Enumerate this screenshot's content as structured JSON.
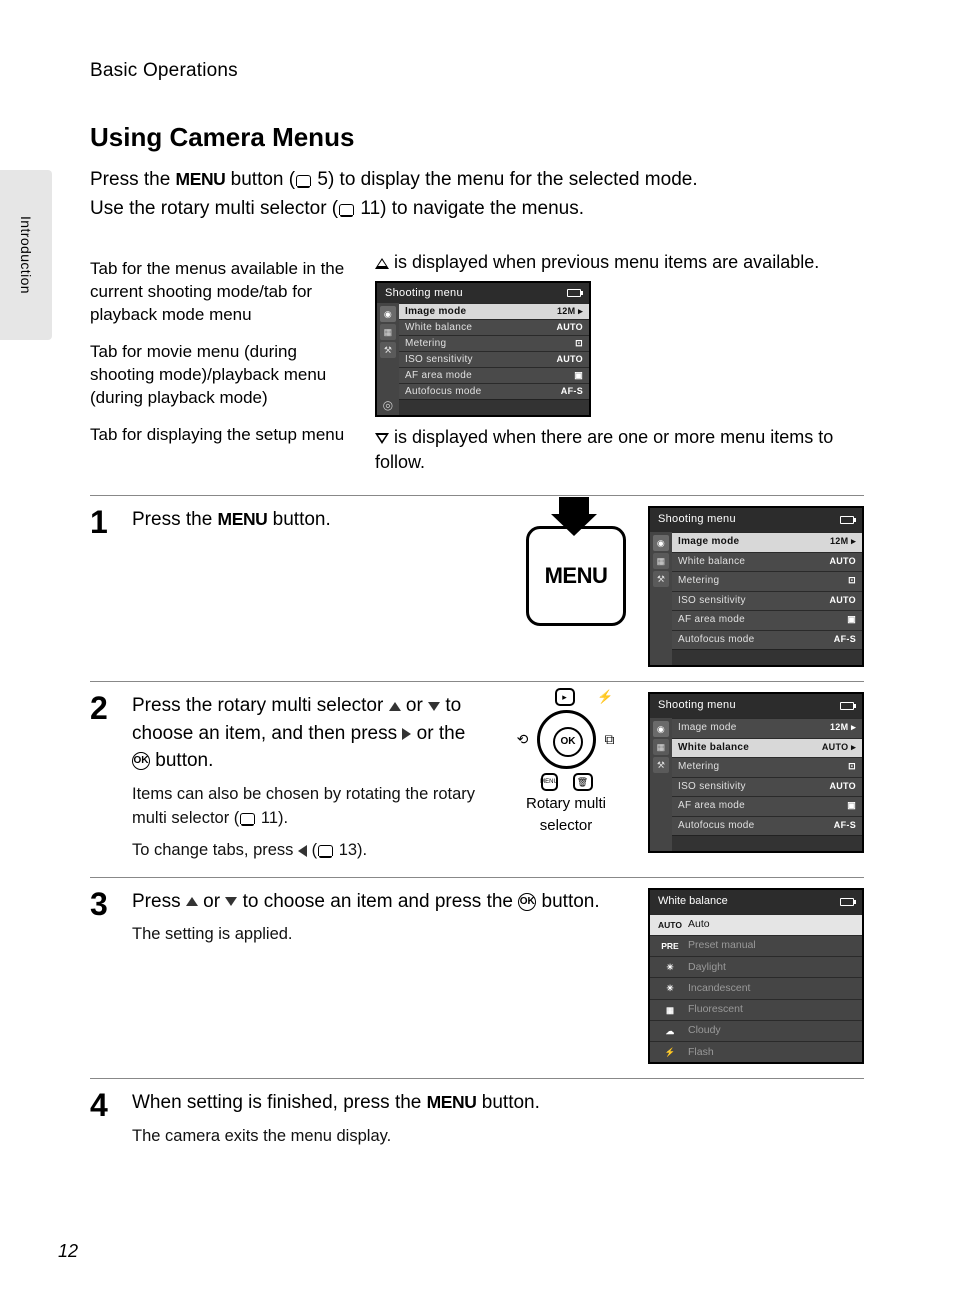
{
  "section_header": "Basic Operations",
  "side_tab": "Introduction",
  "title": "Using Camera Menus",
  "intro_line1_a": "Press the ",
  "intro_line1_b": " button (",
  "intro_line1_c": " 5) to display the menu for the selected mode.",
  "intro_line2_a": "Use the rotary multi selector (",
  "intro_line2_b": " 11) to navigate the menus.",
  "annotations": {
    "tab_shooting": "Tab for the menus available in the current shooting mode/tab for playback mode menu",
    "tab_movie": "Tab for movie menu (during shooting mode)/playback menu (during playback mode)",
    "tab_setup": "Tab for displaying the setup menu"
  },
  "tri_up_note": " is displayed when previous menu items are available.",
  "tri_down_note": " is displayed when there are one or more menu items to follow.",
  "menu_screen": {
    "title": "Shooting menu",
    "items": [
      {
        "label": "Image mode",
        "badge": "12M ▸"
      },
      {
        "label": "White balance",
        "badge": "AUTO"
      },
      {
        "label": "Metering",
        "badge": "⊡"
      },
      {
        "label": "ISO sensitivity",
        "badge": "AUTO"
      },
      {
        "label": "AF area mode",
        "badge": "▣"
      },
      {
        "label": "Autofocus mode",
        "badge": "AF-S"
      }
    ]
  },
  "steps": {
    "s1": {
      "num": "1",
      "text_a": "Press the ",
      "text_b": " button.",
      "menu_btn_label": "MENU"
    },
    "s2": {
      "num": "2",
      "main_a": "Press the rotary multi selector ",
      "main_b": " or ",
      "main_c": " to choose an item, and then press ",
      "main_d": " or the ",
      "main_e": " button.",
      "sub1_a": "Items can also be chosen by rotating the rotary multi selector (",
      "sub1_b": " 11).",
      "sub2_a": "To change tabs, press ",
      "sub2_b": " (",
      "sub2_c": " 13).",
      "rotary_caption": "Rotary multi selector",
      "highlight_row": 1
    },
    "s3": {
      "num": "3",
      "main_a": "Press ",
      "main_b": " or ",
      "main_c": " to choose an item and press the ",
      "main_d": " button.",
      "sub": "The setting is applied.",
      "wb_title": "White balance",
      "wb_items": [
        {
          "icon": "AUTO",
          "label": "Auto",
          "sel": true
        },
        {
          "icon": "PRE",
          "label": "Preset manual"
        },
        {
          "icon": "☀",
          "label": "Daylight"
        },
        {
          "icon": "✳",
          "label": "Incandescent"
        },
        {
          "icon": "▦",
          "label": "Fluorescent"
        },
        {
          "icon": "☁",
          "label": "Cloudy"
        },
        {
          "icon": "⚡",
          "label": "Flash"
        }
      ]
    },
    "s4": {
      "num": "4",
      "main_a": "When setting is finished, press the ",
      "main_b": " button.",
      "sub": "The camera exits the menu display."
    }
  },
  "menu_word": "MENU",
  "ok_word": "OK",
  "page_number": "12"
}
